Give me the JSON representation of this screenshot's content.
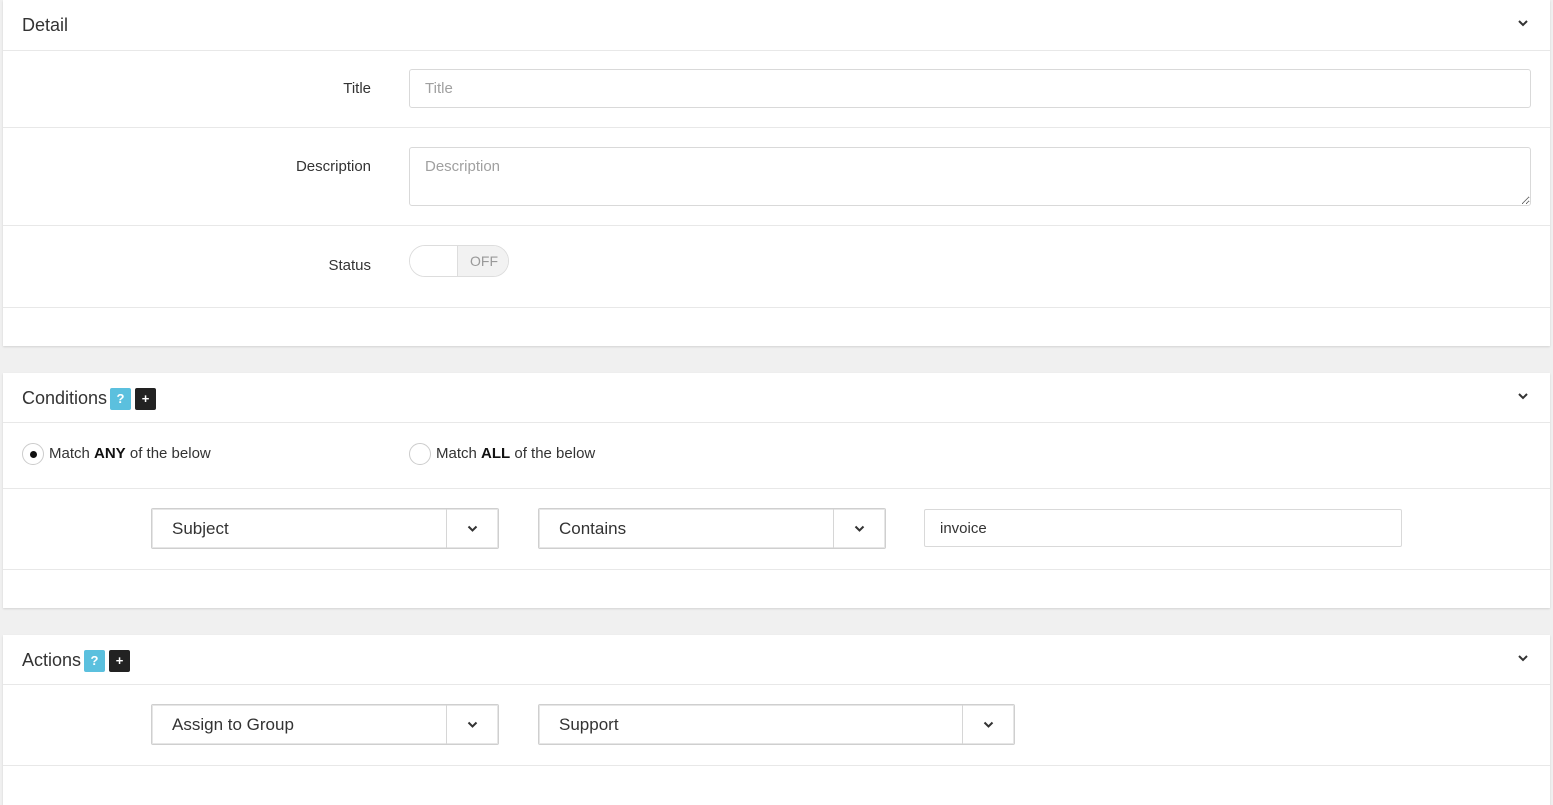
{
  "detail": {
    "title": "Detail",
    "title_label": "Title",
    "title_placeholder": "Title",
    "description_label": "Description",
    "description_placeholder": "Description",
    "status_label": "Status",
    "status_value": "OFF"
  },
  "conditions": {
    "title": "Conditions",
    "help_label": "?",
    "add_label": "+",
    "match_any_prefix": "Match ",
    "match_any_bold": "ANY",
    "match_any_suffix": " of the below",
    "match_all_prefix": "Match ",
    "match_all_bold": "ALL",
    "match_all_suffix": " of the below",
    "selected_match": "ANY",
    "rule": {
      "field": "Subject",
      "operator": "Contains",
      "value": "invoice"
    }
  },
  "actions": {
    "title": "Actions",
    "help_label": "?",
    "add_label": "+",
    "rule": {
      "action": "Assign to Group",
      "target": "Support"
    }
  },
  "icons": {
    "collapse": "chevron-down-icon",
    "select_caret": "chevron-down-icon"
  },
  "colors": {
    "help_badge": "#5bc0de",
    "add_badge": "#222222",
    "background": "#f0f0f0"
  }
}
